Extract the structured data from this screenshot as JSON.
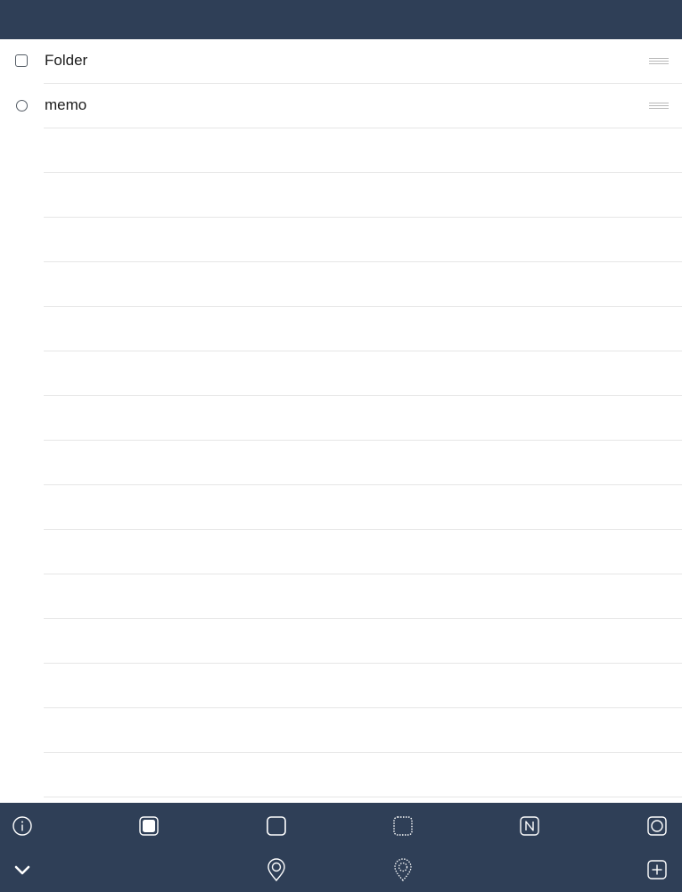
{
  "colors": {
    "bar": "#2f3f57",
    "icon": "#ffffff",
    "divider": "#e6e6e6"
  },
  "list": {
    "items": [
      {
        "label": "Folder",
        "icon": "square-checkbox-icon"
      },
      {
        "label": "memo",
        "icon": "circle-radio-icon"
      }
    ]
  },
  "toolbar": {
    "top_row": [
      "info-icon",
      "filled-square-icon",
      "square-icon",
      "dotted-square-icon",
      "n-square-icon",
      "circle-in-square-icon"
    ],
    "bottom_row": [
      "chevron-down-icon",
      "location-pin-icon",
      "dotted-location-pin-icon",
      "plus-square-icon"
    ]
  }
}
